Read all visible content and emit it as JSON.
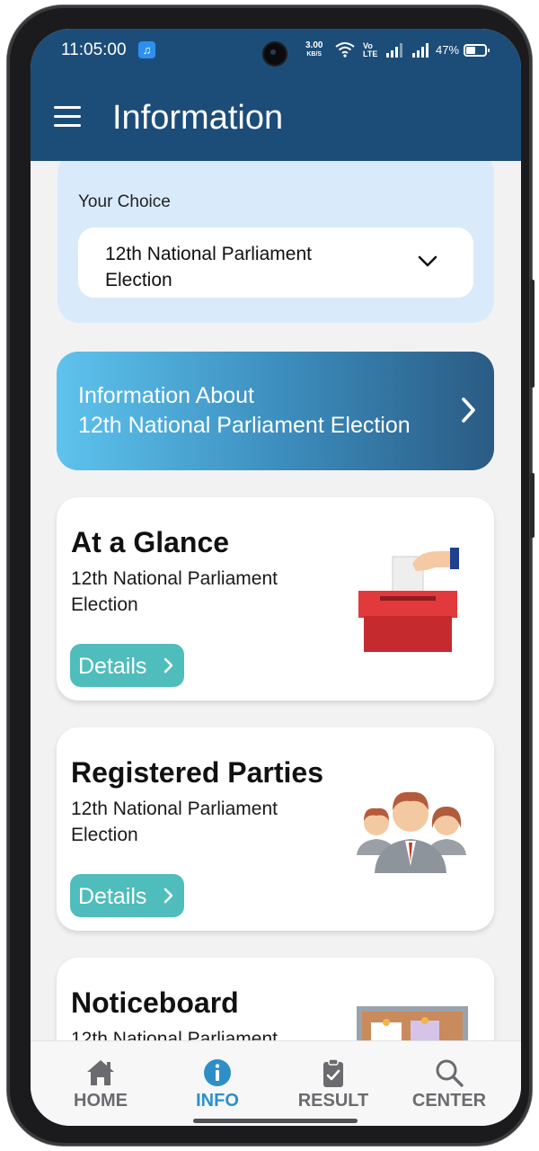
{
  "status_bar": {
    "time": "11:05:00",
    "speed_value": "3.00",
    "speed_unit": "KB/S",
    "volte_top": "Vo",
    "volte_bottom": "LTE",
    "battery": "47%"
  },
  "app_bar": {
    "title": "Information"
  },
  "choice": {
    "label": "Your Choice",
    "selected": "12th National Parliament Election"
  },
  "banner": {
    "line1": "Information About",
    "line2": "12th National Parliament Election"
  },
  "cards": [
    {
      "title": "At a Glance",
      "subtitle": "12th National Parliament Election",
      "button": "Details"
    },
    {
      "title": "Registered Parties",
      "subtitle": "12th National Parliament Election",
      "button": "Details"
    },
    {
      "title": "Noticeboard",
      "subtitle": "12th National Parliament"
    }
  ],
  "bottom_nav": [
    {
      "label": "HOME",
      "icon": "home-icon",
      "active": false
    },
    {
      "label": "INFO",
      "icon": "info-icon",
      "active": true
    },
    {
      "label": "RESULT",
      "icon": "clipboard-icon",
      "active": false
    },
    {
      "label": "CENTER",
      "icon": "search-icon",
      "active": false
    }
  ],
  "colors": {
    "app_bar": "#1c4d78",
    "choice_bg": "#d9ebfb",
    "details_button": "#4fbdbb",
    "nav_active": "#2e8fc7",
    "nav_inactive": "#6b6b6f"
  }
}
